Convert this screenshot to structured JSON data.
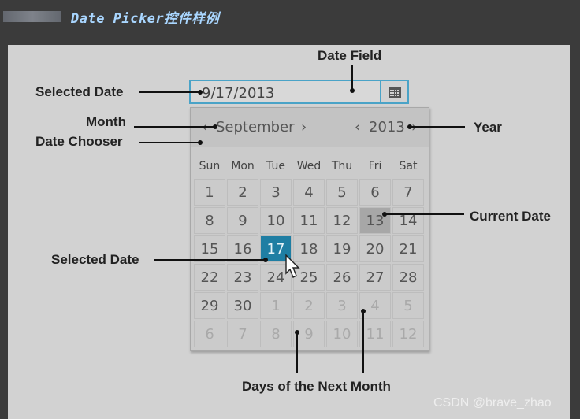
{
  "doc_title": "Date Picker控件样例",
  "date_field": {
    "value": "9/17/2013"
  },
  "labels": {
    "date_field": "Date Field",
    "selected_date_top": "Selected Date",
    "month": "Month",
    "date_chooser": "Date Chooser",
    "year": "Year",
    "current_date": "Current Date",
    "selected_date_bottom": "Selected Date",
    "next_month": "Days of the Next Month"
  },
  "calendar": {
    "month": "September",
    "year": "2013",
    "prev_month_glyph": "‹",
    "next_month_glyph": "›",
    "prev_year_glyph": "‹",
    "next_year_glyph": "›",
    "weekdays": [
      "Sun",
      "Mon",
      "Tue",
      "Wed",
      "Thu",
      "Fri",
      "Sat"
    ],
    "weeks": [
      [
        "1",
        "2",
        "3",
        "4",
        "5",
        "6",
        "7"
      ],
      [
        "8",
        "9",
        "10",
        "11",
        "12",
        "13",
        "14"
      ],
      [
        "15",
        "16",
        "17",
        "18",
        "19",
        "20",
        "21"
      ],
      [
        "22",
        "23",
        "24",
        "25",
        "26",
        "27",
        "28"
      ],
      [
        "29",
        "30",
        "1",
        "2",
        "3",
        "4",
        "5"
      ],
      [
        "6",
        "7",
        "8",
        "9",
        "10",
        "11",
        "12"
      ]
    ],
    "current_day": "13",
    "selected_day": "17"
  },
  "watermark": "CSDN @brave_zhao",
  "icons": {
    "calendar_button": "calendar-icon",
    "cursor": "mouse-pointer-icon"
  },
  "colors": {
    "accent": "#4aa3c7",
    "selected": "#1f7ea3",
    "current": "#a7a7a7"
  }
}
